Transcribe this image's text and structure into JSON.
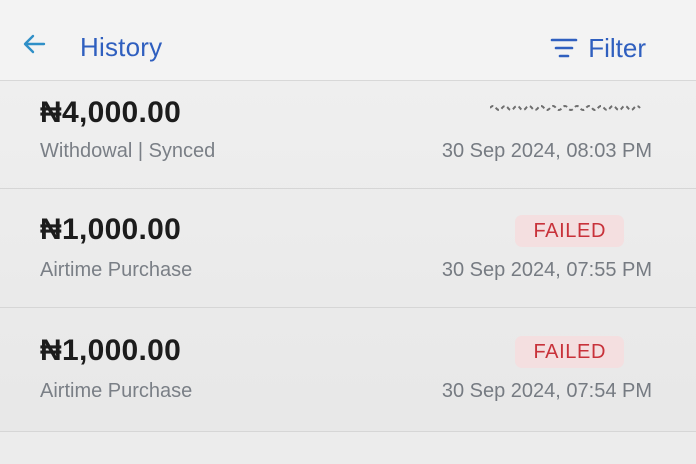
{
  "header": {
    "title": "History",
    "filter_label": "Filter",
    "back_icon": "back-arrow-icon",
    "filter_icon": "filter-lines-icon"
  },
  "colors": {
    "accent": "#2f5fbf",
    "failed_text": "#c8323a",
    "failed_bg": "#f4dfe0"
  },
  "transactions": [
    {
      "amount": "₦4,000.00",
      "description": "Withdowal | Synced",
      "datetime": "30 Sep 2024, 08:03 PM",
      "status": ""
    },
    {
      "amount": "₦1,000.00",
      "description": "Airtime Purchase",
      "datetime": "30 Sep 2024, 07:55 PM",
      "status": "FAILED"
    },
    {
      "amount": "₦1,000.00",
      "description": "Airtime Purchase",
      "datetime": "30 Sep 2024, 07:54 PM",
      "status": "FAILED"
    }
  ]
}
